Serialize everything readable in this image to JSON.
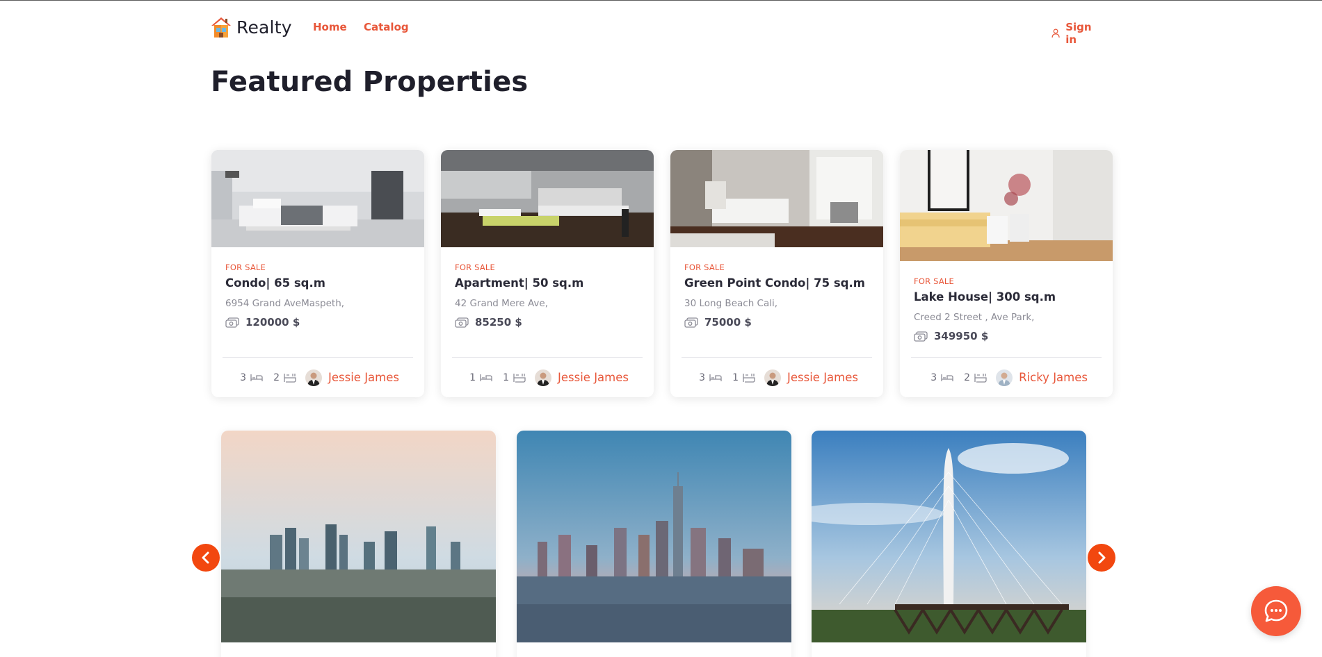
{
  "nav": {
    "brand": "Realty",
    "links": [
      "Home",
      "Catalog"
    ],
    "sign_in": "Sign in"
  },
  "page_title": "Featured Properties",
  "properties": [
    {
      "tag": "FOR SALE",
      "title": "Condo| 65 sq.m",
      "address": "6954 Grand AveMaspeth,",
      "price": "120000 $",
      "bedrooms": "3",
      "bathrooms": "2",
      "agent": "Jessie James"
    },
    {
      "tag": "FOR SALE",
      "title": "Apartment| 50 sq.m",
      "address": "42 Grand Mere Ave,",
      "price": "85250 $",
      "bedrooms": "1",
      "bathrooms": "1",
      "agent": "Jessie James"
    },
    {
      "tag": "FOR SALE",
      "title": "Green Point Condo| 75 sq.m",
      "address": "30 Long Beach Cali,",
      "price": "75000 $",
      "bedrooms": "3",
      "bathrooms": "1",
      "agent": "Jessie James"
    },
    {
      "tag": "FOR SALE",
      "title": "Lake House| 300 sq.m",
      "address": "Creed 2 Street , Ave Park,",
      "price": "349950 $",
      "bedrooms": "3",
      "bathrooms": "2",
      "agent": "Ricky James"
    }
  ],
  "icons": {
    "logo": "house-logo-icon",
    "sign_in": "user-icon",
    "price": "money-icon",
    "bedrooms": "bed-icon",
    "bathrooms": "bath-icon",
    "prev": "chevron-left-icon",
    "next": "chevron-right-icon",
    "chat": "chat-bubble-icon"
  },
  "colors": {
    "accent": "#e8573a",
    "arrow": "#f2470f",
    "chat": "#f65a3a",
    "heading": "#1f1f2b"
  }
}
